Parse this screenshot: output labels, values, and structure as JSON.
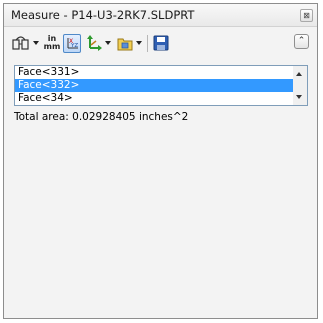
{
  "window": {
    "title": "Measure - P14-U3-2RK7.SLDPRT",
    "close_glyph": "⊠"
  },
  "toolbar": {
    "units_top": "in",
    "units_bottom": "mm",
    "axes_x": "X",
    "axes_yz": "YZ",
    "collapse_glyph": "⌃",
    "icons": [
      "measure-tool-icon",
      "units-precision-icon",
      "show-xyz-icon",
      "point-to-point-icon",
      "selection-filter-icon",
      "save-icon"
    ]
  },
  "faces": [
    {
      "label": "Face<331>",
      "selected": false
    },
    {
      "label": "Face<332>",
      "selected": true
    },
    {
      "label": "Face<34>",
      "selected": false
    }
  ],
  "result": {
    "total_area": "Total area: 0.02928405 inches^2"
  },
  "colors": {
    "selection": "#3399ff",
    "list_border": "#7f9db9"
  }
}
